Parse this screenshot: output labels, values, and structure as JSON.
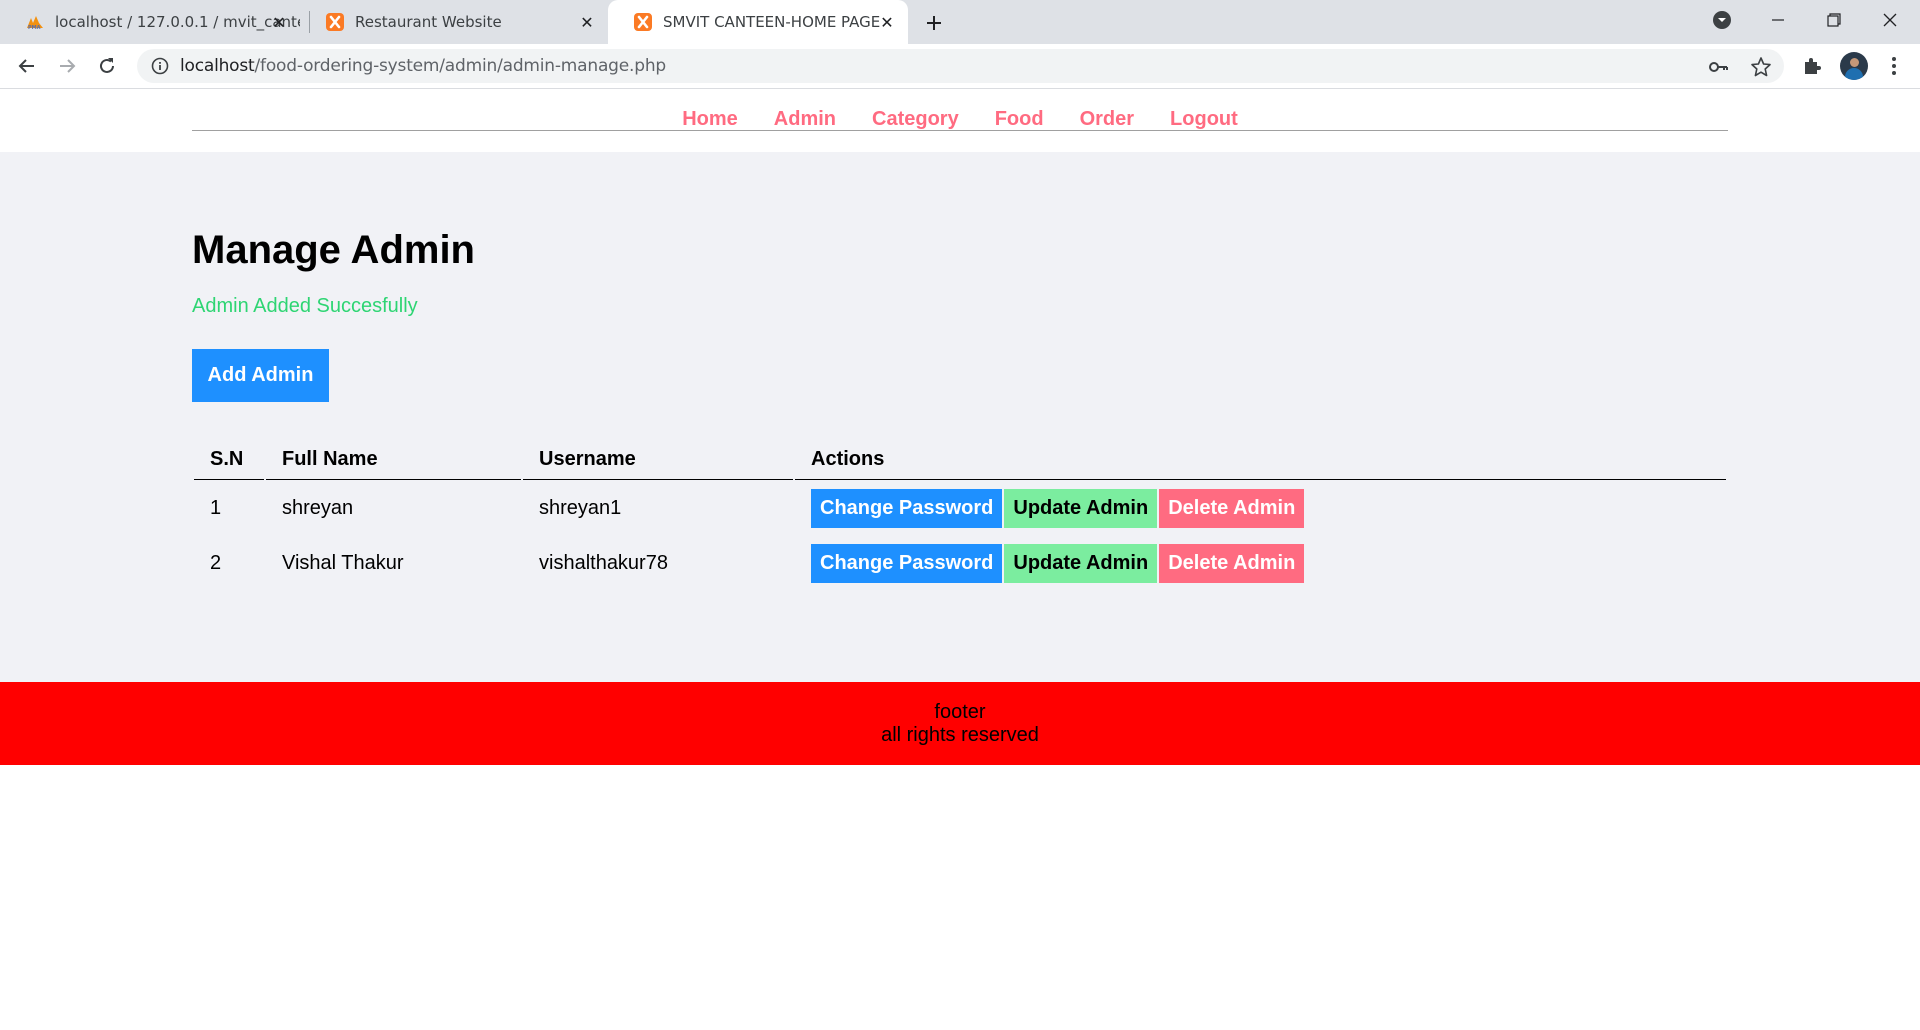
{
  "browser": {
    "tabs": [
      {
        "title": "localhost / 127.0.0.1 / mvit_canteen",
        "icon": "phpmyadmin-icon",
        "active": false
      },
      {
        "title": "Restaurant Website",
        "icon": "xampp-icon",
        "active": false
      },
      {
        "title": "SMVIT CANTEEN-HOME PAGE",
        "icon": "xampp-icon",
        "active": true
      }
    ],
    "url_host": "localhost",
    "url_path": "/food-ordering-system/admin/admin-manage.php"
  },
  "nav": {
    "items": [
      "Home",
      "Admin",
      "Category",
      "Food",
      "Order",
      "Logout"
    ]
  },
  "main": {
    "title": "Manage Admin",
    "message": "Admin Added Succesfully",
    "add_button": "Add Admin",
    "table": {
      "headers": [
        "S.N",
        "Full Name",
        "Username",
        "Actions"
      ],
      "rows": [
        {
          "sn": "1",
          "full_name": "shreyan",
          "username": "shreyan1"
        },
        {
          "sn": "2",
          "full_name": "Vishal Thakur",
          "username": "vishalthakur78"
        }
      ],
      "actions": {
        "change_password": "Change Password",
        "update": "Update Admin",
        "delete": "Delete Admin"
      }
    }
  },
  "footer": {
    "line1": "footer",
    "line2": "all rights reserved"
  },
  "colors": {
    "nav_link": "#ff6b81",
    "success": "#2ed573",
    "primary": "#1e90ff",
    "secondary": "#7bed9f",
    "danger": "#ff6b81",
    "footer_bg": "#ff0000",
    "main_bg": "#f1f2f6"
  }
}
